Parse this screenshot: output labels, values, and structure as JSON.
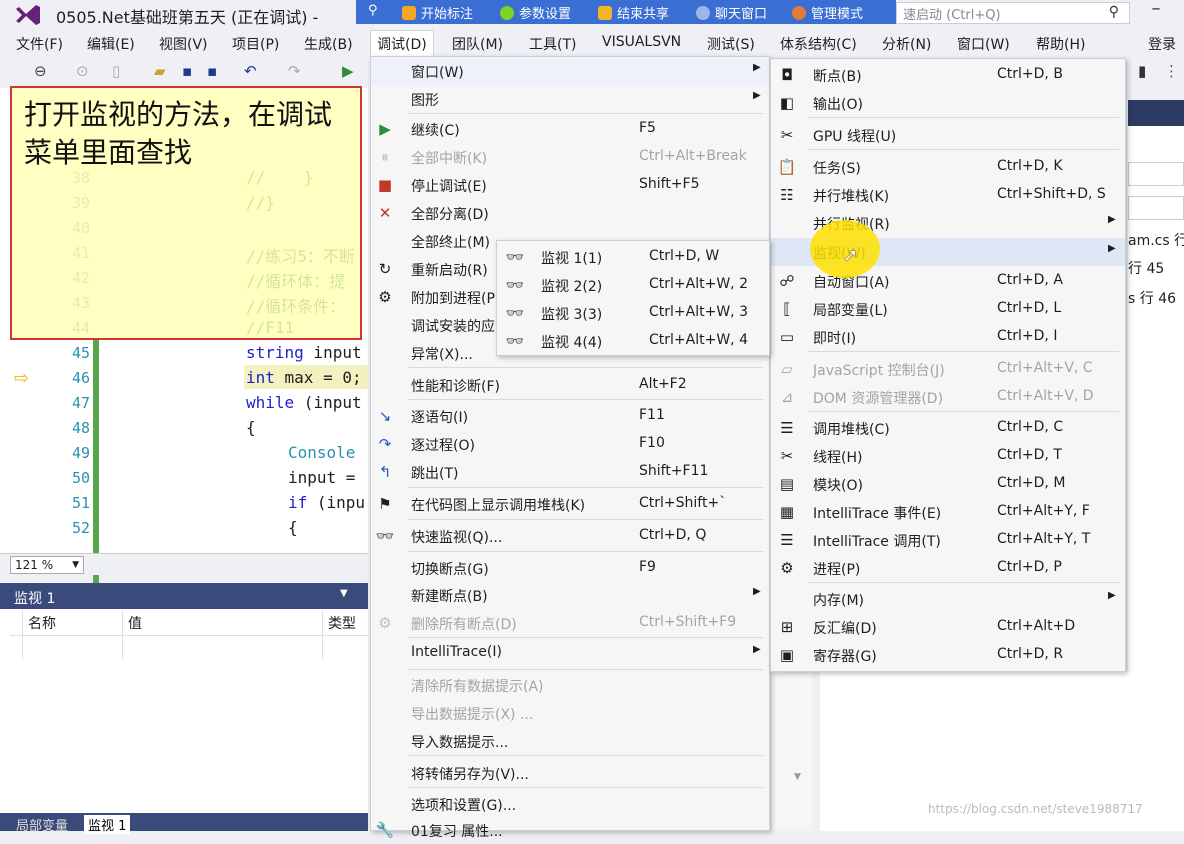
{
  "window": {
    "title": "0505.Net基础班第五天 (正在调试) -",
    "quick_launch": "速启动 (Ctrl+Q)",
    "minimize": "–"
  },
  "overlay_toolbar": {
    "items": [
      {
        "label": "开始标注",
        "color": "#f5a623"
      },
      {
        "label": "参数设置",
        "color": "#7ed321"
      },
      {
        "label": "结束共享",
        "color": "#f0b429"
      },
      {
        "label": "聊天窗口",
        "color": "#9ab7e8"
      },
      {
        "label": "管理模式",
        "color": "#e07b39"
      }
    ]
  },
  "menubar": {
    "items": [
      "文件(F)",
      "编辑(E)",
      "视图(V)",
      "项目(P)",
      "生成(B)",
      "调试(D)",
      "团队(M)",
      "工具(T)",
      "VISUALSVN",
      "测试(S)",
      "体系结构(C)",
      "分析(N)",
      "窗口(W)",
      "帮助(H)"
    ],
    "login": "登录"
  },
  "editor": {
    "line_numbers": [
      "38",
      "39",
      "40",
      "41",
      "42",
      "43",
      "44",
      "45",
      "46",
      "47",
      "48",
      "49",
      "50",
      "51",
      "52"
    ],
    "code_lines": [
      {
        "text": "//    }",
        "cls": "cm"
      },
      {
        "text": "//}",
        "cls": "cm"
      },
      {
        "text": "",
        "cls": "cm"
      },
      {
        "text": "//练习5：不断",
        "cls": "cm"
      },
      {
        "text": "//循环体：提",
        "cls": "cm"
      },
      {
        "text": "//循环条件：",
        "cls": "cm"
      },
      {
        "text": "//F11",
        "cls": "cm"
      },
      {
        "kw": "",
        "ty": "string",
        "rest": " input"
      },
      {
        "kw": "",
        "ty": "int",
        "rest": " max = 0;"
      },
      {
        "kw": "while",
        "ty": "",
        "rest": " (input"
      },
      {
        "kw": "",
        "ty": "",
        "rest": "{"
      },
      {
        "kw": "",
        "ty": "Console",
        "rest": ""
      },
      {
        "kw": "",
        "ty": "",
        "rest": "input ="
      },
      {
        "kw": "if",
        "ty": "",
        "rest": " (inpu"
      },
      {
        "kw": "",
        "ty": "",
        "rest": "{"
      }
    ],
    "zoom": "121 %"
  },
  "annotation": {
    "text": "打开监视的方法，在调试菜单里面查找"
  },
  "watch_panel": {
    "title": "监视 1",
    "columns": [
      "名称",
      "值",
      "类型"
    ],
    "tabs": [
      "局部变量",
      "监视 1"
    ]
  },
  "right_fragments": [
    "am.cs 行",
    "行 45",
    "s 行 46"
  ],
  "debug_menu": {
    "items": [
      {
        "icon": "",
        "label": "窗口(W)",
        "shortcut": "",
        "submenu": true,
        "disabled": false
      },
      {
        "icon": "",
        "label": "图形",
        "shortcut": "",
        "submenu": true,
        "disabled": false
      },
      {
        "icon": "▶",
        "label": "继续(C)",
        "shortcut": "F5",
        "submenu": false,
        "disabled": false
      },
      {
        "icon": "⏸",
        "label": "全部中断(K)",
        "shortcut": "Ctrl+Alt+Break",
        "submenu": false,
        "disabled": true
      },
      {
        "icon": "■",
        "label": "停止调试(E)",
        "shortcut": "Shift+F5",
        "submenu": false,
        "disabled": false
      },
      {
        "icon": "✕",
        "label": "全部分离(D)",
        "shortcut": "",
        "submenu": false,
        "disabled": false
      },
      {
        "icon": "",
        "label": "全部终止(M)",
        "shortcut": "",
        "submenu": false,
        "disabled": false
      },
      {
        "icon": "↻",
        "label": "重新启动(R)",
        "shortcut": "",
        "submenu": false,
        "disabled": false
      },
      {
        "icon": "⚙",
        "label": "附加到进程(P",
        "shortcut": "",
        "submenu": false,
        "disabled": false
      },
      {
        "icon": "",
        "label": "调试安装的应",
        "shortcut": "",
        "submenu": false,
        "disabled": false
      },
      {
        "icon": "",
        "label": "异常(X)...",
        "shortcut": "",
        "submenu": false,
        "disabled": false
      },
      {
        "icon": "",
        "label": "性能和诊断(F)",
        "shortcut": "Alt+F2",
        "submenu": false,
        "disabled": false
      },
      {
        "icon": "↘",
        "label": "逐语句(I)",
        "shortcut": "F11",
        "submenu": false,
        "disabled": false
      },
      {
        "icon": "↷",
        "label": "逐过程(O)",
        "shortcut": "F10",
        "submenu": false,
        "disabled": false
      },
      {
        "icon": "↰",
        "label": "跳出(T)",
        "shortcut": "Shift+F11",
        "submenu": false,
        "disabled": false
      },
      {
        "icon": "⚑",
        "label": "在代码图上显示调用堆栈(K)",
        "shortcut": "Ctrl+Shift+`",
        "submenu": false,
        "disabled": false
      },
      {
        "icon": "👓",
        "label": "快速监视(Q)...",
        "shortcut": "Ctrl+D, Q",
        "submenu": false,
        "disabled": false
      },
      {
        "icon": "",
        "label": "切换断点(G)",
        "shortcut": "F9",
        "submenu": false,
        "disabled": false
      },
      {
        "icon": "",
        "label": "新建断点(B)",
        "shortcut": "",
        "submenu": true,
        "disabled": false
      },
      {
        "icon": "⚙",
        "label": "删除所有断点(D)",
        "shortcut": "Ctrl+Shift+F9",
        "submenu": false,
        "disabled": true
      },
      {
        "icon": "",
        "label": "IntelliTrace(I)",
        "shortcut": "",
        "submenu": true,
        "disabled": false
      },
      {
        "icon": "",
        "label": "清除所有数据提示(A)",
        "shortcut": "",
        "submenu": false,
        "disabled": true
      },
      {
        "icon": "",
        "label": "导出数据提示(X) ...",
        "shortcut": "",
        "submenu": false,
        "disabled": true
      },
      {
        "icon": "",
        "label": "导入数据提示...",
        "shortcut": "",
        "submenu": false,
        "disabled": false
      },
      {
        "icon": "",
        "label": "将转储另存为(V)...",
        "shortcut": "",
        "submenu": false,
        "disabled": false
      },
      {
        "icon": "",
        "label": "选项和设置(G)...",
        "shortcut": "",
        "submenu": false,
        "disabled": false
      },
      {
        "icon": "🔧",
        "label": "01复习 属性...",
        "shortcut": "",
        "submenu": false,
        "disabled": false
      }
    ]
  },
  "window_submenu": {
    "items": [
      {
        "icon": "◘",
        "label": "断点(B)",
        "shortcut": "Ctrl+D, B",
        "submenu": false,
        "disabled": false
      },
      {
        "icon": "◧",
        "label": "输出(O)",
        "shortcut": "",
        "submenu": false,
        "disabled": false
      },
      {
        "icon": "✂",
        "label": "GPU 线程(U)",
        "shortcut": "",
        "submenu": false,
        "disabled": false
      },
      {
        "icon": "📋",
        "label": "任务(S)",
        "shortcut": "Ctrl+D, K",
        "submenu": false,
        "disabled": false
      },
      {
        "icon": "☷",
        "label": "并行堆栈(K)",
        "shortcut": "Ctrl+Shift+D, S",
        "submenu": false,
        "disabled": false
      },
      {
        "icon": "",
        "label": "并行监视(R)",
        "shortcut": "",
        "submenu": true,
        "disabled": false
      },
      {
        "icon": "",
        "label": "监视(W)",
        "shortcut": "",
        "submenu": true,
        "disabled": false
      },
      {
        "icon": "☍",
        "label": "自动窗口(A)",
        "shortcut": "Ctrl+D, A",
        "submenu": false,
        "disabled": false
      },
      {
        "icon": "⟦",
        "label": "局部变量(L)",
        "shortcut": "Ctrl+D, L",
        "submenu": false,
        "disabled": false
      },
      {
        "icon": "▭",
        "label": "即时(I)",
        "shortcut": "Ctrl+D, I",
        "submenu": false,
        "disabled": false
      },
      {
        "icon": "▱",
        "label": "JavaScript 控制台(J)",
        "shortcut": "Ctrl+Alt+V, C",
        "submenu": false,
        "disabled": true
      },
      {
        "icon": "⊿",
        "label": "DOM 资源管理器(D)",
        "shortcut": "Ctrl+Alt+V, D",
        "submenu": false,
        "disabled": true
      },
      {
        "icon": "☰",
        "label": "调用堆栈(C)",
        "shortcut": "Ctrl+D, C",
        "submenu": false,
        "disabled": false
      },
      {
        "icon": "✂",
        "label": "线程(H)",
        "shortcut": "Ctrl+D, T",
        "submenu": false,
        "disabled": false
      },
      {
        "icon": "▤",
        "label": "模块(O)",
        "shortcut": "Ctrl+D, M",
        "submenu": false,
        "disabled": false
      },
      {
        "icon": "▦",
        "label": "IntelliTrace 事件(E)",
        "shortcut": "Ctrl+Alt+Y, F",
        "submenu": false,
        "disabled": false
      },
      {
        "icon": "☰",
        "label": "IntelliTrace 调用(T)",
        "shortcut": "Ctrl+Alt+Y, T",
        "submenu": false,
        "disabled": false
      },
      {
        "icon": "⚙",
        "label": "进程(P)",
        "shortcut": "Ctrl+D, P",
        "submenu": false,
        "disabled": false
      },
      {
        "icon": "",
        "label": "内存(M)",
        "shortcut": "",
        "submenu": true,
        "disabled": false
      },
      {
        "icon": "⊞",
        "label": "反汇编(D)",
        "shortcut": "Ctrl+Alt+D",
        "submenu": false,
        "disabled": false
      },
      {
        "icon": "▣",
        "label": "寄存器(G)",
        "shortcut": "Ctrl+D, R",
        "submenu": false,
        "disabled": false
      }
    ]
  },
  "watch_submenu": {
    "items": [
      {
        "icon": "👓",
        "label": "监视 1(1)",
        "shortcut": "Ctrl+D, W"
      },
      {
        "icon": "👓",
        "label": "监视 2(2)",
        "shortcut": "Ctrl+Alt+W, 2"
      },
      {
        "icon": "👓",
        "label": "监视 3(3)",
        "shortcut": "Ctrl+Alt+W, 3"
      },
      {
        "icon": "👓",
        "label": "监视 4(4)",
        "shortcut": "Ctrl+Alt+W, 4"
      }
    ]
  },
  "watermark": "https://blog.csdn.net/steve1988717"
}
